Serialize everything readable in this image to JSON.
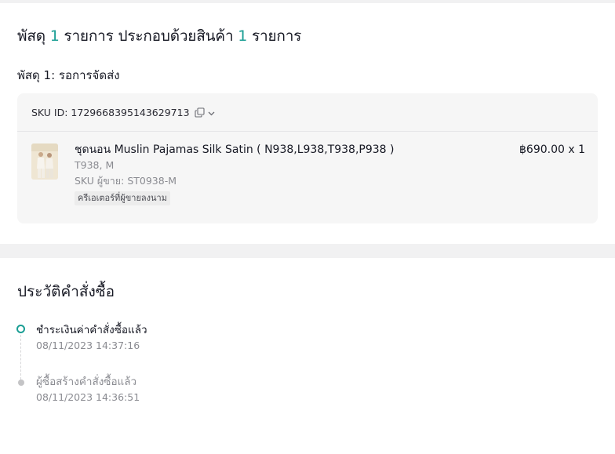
{
  "summary": {
    "prefix": "พัสดุ ",
    "package_count": "1",
    "middle": " รายการ ประกอบด้วยสินค้า ",
    "item_count": "1",
    "suffix": " รายการ"
  },
  "package": {
    "title": "พัสดุ 1: รอการจัดส่ง",
    "sku_id_label": "SKU ID: 1729668395143629713",
    "item": {
      "name": "ชุดนอน Muslin Pajamas Silk Satin ( N938,L938,T938,P938 )",
      "variant": "T938, M",
      "seller_sku": "SKU ผู้ขาย: ST0938-M",
      "badge": "ครีเอเตอร์ที่ผู้ขายลงนาม",
      "price_qty": "฿690.00 x 1"
    }
  },
  "history": {
    "title": "ประวัติคำสั่งซื้อ",
    "events": [
      {
        "label": "ชำระเงินค่าคำสั่งซื้อแล้ว",
        "time": "08/11/2023 14:37:16"
      },
      {
        "label": "ผู้ซื้อสร้างคำสั่งซื้อแล้ว",
        "time": "08/11/2023 14:36:51"
      }
    ]
  },
  "colors": {
    "accent": "#1a9e94",
    "muted": "#8a8b91",
    "card_bg": "#f6f6f6"
  }
}
